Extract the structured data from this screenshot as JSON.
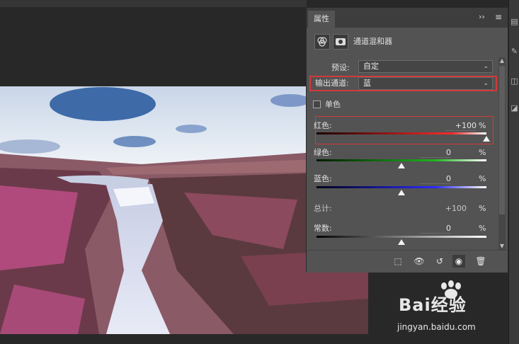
{
  "panel": {
    "tab_label": "属性",
    "collapse_label": "››",
    "menu_label": "≡",
    "adjustment_title": "通道混和器"
  },
  "preset": {
    "label": "预设:",
    "value": "自定"
  },
  "output_channel": {
    "label": "输出通道:",
    "value": "蓝"
  },
  "monochrome": {
    "label": "单色",
    "checked": false
  },
  "sliders": [
    {
      "label": "红色:",
      "value": "+100",
      "unit": "%",
      "level": 1.0
    },
    {
      "label": "绿色:",
      "value": "0",
      "unit": "%",
      "level": 0.5
    },
    {
      "label": "蓝色:",
      "value": "0",
      "unit": "%",
      "level": 0.5
    }
  ],
  "total": {
    "label": "总计:",
    "value": "+100",
    "unit": "%"
  },
  "constant": {
    "label": "常数:",
    "value": "0",
    "unit": "%",
    "level": 0.5
  },
  "footer_icons": [
    "clip-to-layer-icon",
    "view-previous-icon",
    "reset-icon",
    "visibility-eye-icon",
    "trash-icon"
  ],
  "watermark": {
    "main": "Bai经验",
    "sub": "jingyan.baidu.com"
  },
  "colors": {
    "highlight_box": "#d23a3a",
    "panel_bg": "#535353",
    "canvas_bg": "#282828"
  }
}
